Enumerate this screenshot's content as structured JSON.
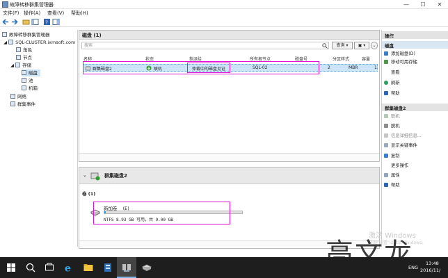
{
  "window": {
    "title": "故障转移群集管理器",
    "minimize": "—",
    "maximize": "☐",
    "close": "✕"
  },
  "menu": [
    "文件(F)",
    "操作(A)",
    "查看(V)",
    "帮助(H)"
  ],
  "tree": {
    "root": "故障转移群集管理器",
    "cluster": "SQL-CLUSTER.ixmsoft.com",
    "roles": "角色",
    "nodes": "节点",
    "storage": "存储",
    "disks": "磁盘",
    "pools": "池",
    "enclosures": "机箱",
    "networks": "网络",
    "events": "群集事件"
  },
  "disks_pane": {
    "title": "磁盘 (1)",
    "search_placeholder": "搜索",
    "query_button": "查询",
    "columns": [
      "名称",
      "状态",
      "指派给",
      "所有者节点",
      "磁盘号",
      "分区样式",
      "容量"
    ],
    "rows": [
      {
        "name": "群集磁盘2",
        "status": "联机",
        "assigned_to": "仲裁中的磁盘见证",
        "owner": "SQL-02",
        "disk_number": "2",
        "partition_style": "MBR",
        "capacity": "1"
      }
    ]
  },
  "details_pane": {
    "disk_name": "群集磁盘2",
    "volumes_label": "卷 (1)",
    "volume_name": "新加卷",
    "volume_letter": "(E)",
    "volume_info": "NTFS 8.93 GB 可用，共 9.00 GB",
    "usage_fraction": 0.008
  },
  "actions": {
    "header": "操作",
    "section1": "磁盘",
    "section1_items": [
      "添加磁盘(D)",
      "移动可用存储",
      "查看",
      "刷新",
      "帮助"
    ],
    "section2": "群集磁盘2",
    "section2_items": [
      "联机",
      "脱机",
      "信息详细信息...",
      "显示关键事件",
      "复制",
      "更多操作",
      "属性",
      "帮助"
    ]
  },
  "watermark": {
    "line1": "激活 Windows",
    "line2": "转到\"设置\"以激活 Windows。",
    "name": "高文龙"
  },
  "taskbar": {
    "lang": "ENG",
    "time": "13:48",
    "date": "2016/11/"
  },
  "colors": {
    "highlight": "#e010d8",
    "selection": "#cce4f7",
    "online_green": "#2e9a2e",
    "taskbar": "#1e1e1e"
  }
}
